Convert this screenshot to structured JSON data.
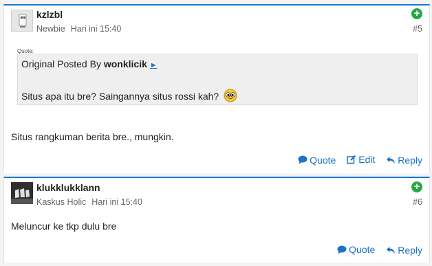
{
  "posts": [
    {
      "username": "kzlzbl",
      "rank": "Newbie",
      "time": "Hari ini 15:40",
      "number": "#5",
      "quote": {
        "label": "Quote:",
        "prefix": "Original Posted By ",
        "author": "wonklicik",
        "link_glyph": "►",
        "text": "Situs apa itu bre? Saingannya situs rossi kah?"
      },
      "body": "Situs rangkuman berita bre., mungkin.",
      "actions": {
        "quote": "Quote",
        "edit": "Edit",
        "reply": "Reply"
      }
    },
    {
      "username": "klukklukklann",
      "rank": "Kaskus Holic",
      "time": "Hari ini 15:40",
      "number": "#6",
      "body": "Meluncur ke tkp dulu bre",
      "actions": {
        "quote": "Quote",
        "reply": "Reply"
      }
    }
  ],
  "colors": {
    "accent": "#1976d2",
    "link": "#1a73c6",
    "plus": "#27a844"
  }
}
